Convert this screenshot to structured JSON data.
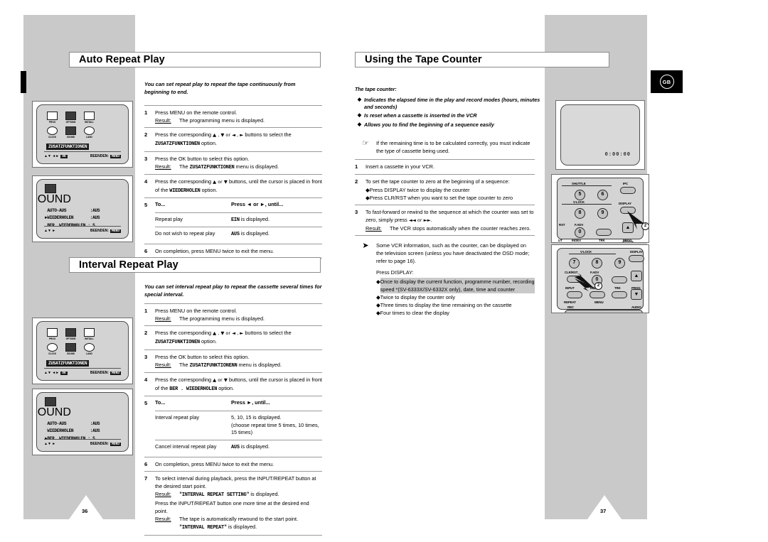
{
  "document": {
    "language_badge": "GB",
    "left_page_number": "36",
    "right_page_number": "37"
  },
  "left_page": {
    "sections": [
      {
        "title": "Auto Repeat Play",
        "intro": "You can set repeat play to repeat the tape continuously from beginning to end.",
        "steps": [
          {
            "num": "1",
            "text": "Press MENU on the remote control.",
            "result_label": "Result:",
            "result": "The programming menu is displayed."
          },
          {
            "num": "2",
            "text_a": "Press the corresponding",
            "keys": "▲ , ▼ or ◄ , ►",
            "text_b": "buttons to select the",
            "mono": "ZUSATZFUNKTIONEN",
            "text_c": "option."
          },
          {
            "num": "3",
            "text": "Press the OK  button to select this option.",
            "result_label": "Result:",
            "result_a": "The",
            "mono": "ZUSATZFUNKTIONEN",
            "result_b": "menu is displayed."
          },
          {
            "num": "4",
            "text_a": "Press the corresponding",
            "keys": "▲ or ▼",
            "text_b": "buttons, until the cursor is placed in front of the",
            "mono": "WIEDERHOLEN",
            "text_c": "option."
          },
          {
            "num": "5",
            "col1_header": "To...",
            "col2_header": "Press ◄ or ►, until...",
            "rows": [
              {
                "c1": "Repeat play",
                "c2_mono": "EIN",
                "c2": "is displayed."
              },
              {
                "c1": "Do not wish to repeat play",
                "c2_mono": "AUS",
                "c2": "is displayed."
              }
            ]
          },
          {
            "num": "6",
            "text": "On completion, press MENU twice to exit the menu."
          }
        ],
        "osd_menu": {
          "icons": [
            {
              "label": "PROG"
            },
            {
              "label": "OPTIONS"
            },
            {
              "label": "INSTALL"
            },
            {
              "label": "CLOCK"
            },
            {
              "label": "SOUND"
            },
            {
              "label": "LANG"
            }
          ],
          "highlight": "ZUSATZFUNKTIONEN",
          "footer_left": "▲▼  ◄►",
          "footer_key": "OK",
          "footer_right": "BEENDEN:",
          "footer_right_key": "MENU"
        },
        "osd_sub": {
          "icon_label": "SOUND",
          "lines": [
            " AUTO-AUS          :AUS",
            "►WIEDERHOLEN       :AUS",
            " BER. WIEDERHOLEN : 5"
          ],
          "footer_left": "▲▼    ►",
          "footer_right": "BEENDEN:",
          "footer_right_key": "MENU"
        }
      },
      {
        "title": "Interval Repeat Play",
        "intro": "You can set interval repeat play to repeat the cassette several times for special interval.",
        "steps": [
          {
            "num": "1",
            "text": "Press MENU on the remote control.",
            "result_label": "Result:",
            "result": "The programming menu is displayed."
          },
          {
            "num": "2",
            "text_a": "Press the corresponding",
            "keys": "▲ , ▼ or ◄ , ►",
            "text_b": "buttons to select the",
            "mono": "ZUSATZFUNKTIONEN",
            "text_c": "option."
          },
          {
            "num": "3",
            "text": "Press the OK button to select this option.",
            "result_label": "Result:",
            "result_a": "The",
            "mono": "ZUSATZFUNKTIONENN",
            "result_b": "menu is displayed."
          },
          {
            "num": "4",
            "text_a": "Press the corresponding",
            "keys": "▲ or ▼",
            "text_b": "buttons, until the cursor is placed in front of the",
            "mono": "BER . WIEDERHOLEN",
            "text_c": "option."
          },
          {
            "num": "5",
            "col1_header": "To...",
            "col2_header": "Press ►, until...",
            "rows": [
              {
                "c1": "Interval repeat play",
                "c2": "5, 10, 15 is displayed.",
                "c2_extra": "(choose repeat time 5 times, 10 times, 15 times)"
              },
              {
                "c1": "Cancel interval repeat play",
                "c2_mono": "AUS",
                "c2": "is displayed."
              }
            ]
          },
          {
            "num": "6",
            "text": "On completion, press MENU twice to exit the menu."
          },
          {
            "num": "7",
            "text": "To select interval during playback, press the INPUT/REPEAT button at the desired start point.",
            "result_label": "Result:",
            "result_mono": "\"INTERVAL REPEAT SETTING\"",
            "result_tail": "is displayed.",
            "text2": "Press the INPUT/REPEAT button one more time at the desired end point.",
            "result_label2": "Result:",
            "result2": "The tape is automatically rewound to the start point.",
            "result2_mono": "\"INTERVAL REPEAT\"",
            "result2_tail": "is displayed."
          }
        ],
        "osd_menu": {
          "icons": [
            {
              "label": "PROG"
            },
            {
              "label": "OPTIONS"
            },
            {
              "label": "INSTALL"
            },
            {
              "label": "CLOCK"
            },
            {
              "label": "SOUND"
            },
            {
              "label": "LANG"
            }
          ],
          "highlight": "ZUSATZFUNKTIONEN",
          "footer_left": "▲▼  ◄►",
          "footer_key": "OK",
          "footer_right": "BEENDEN:",
          "footer_right_key": "MENU"
        },
        "osd_sub": {
          "icon_label": "SOUND",
          "lines": [
            " AUTO-AUS          :AUS",
            " WIEDERHOLEN       :AUS",
            "►BER. WIEDERHOLEN : 5"
          ],
          "footer_left": "▲▼    ►",
          "footer_right": "BEENDEN:",
          "footer_right_key": "MENU"
        }
      }
    ]
  },
  "right_page": {
    "section": {
      "title": "Using the Tape Counter",
      "lead": "The tape counter:",
      "bullets": [
        "Indicates the elapsed time in the play and record modes (hours, minutes and seconds)",
        "Is reset when a cassette is inserted in the VCR",
        "Allows you to find the beginning of a sequence easily"
      ],
      "hand_note": "If the remaining time is to be calculated correctly, you must indicate the type of cassette being used.",
      "steps": [
        {
          "num": "1",
          "text": "Insert a cassette in your VCR."
        },
        {
          "num": "2",
          "text": "To set the tape counter to zero at the beginning of a sequence:",
          "bullets": [
            "Press DISPLAY twice to display the counter",
            "Press CLR/RST when you want to set the tape counter to zero"
          ]
        },
        {
          "num": "3",
          "text_a": "To fast-forward or rewind to the sequence at which the counter was set to zero, simply press",
          "keys": "◄◄ or ►►",
          "text_b": ".",
          "result_label": "Result:",
          "result": "The VCR stops automatically when the counter reaches zero."
        }
      ],
      "arrow_note": {
        "text": "Some VCR information, such as the counter, can be displayed on the television screen (unless you have deactivated the OSD mode; refer to page 16).",
        "press_label": "Press DISPLAY:",
        "bullets": [
          "Once to display the current function, programme number, recording speed *(SV-6333X/SV-6332X only), date, time and counter",
          "Twice to display the counter only",
          "Three times to display the time remaining on the cassette",
          "Four times to clear the display"
        ]
      },
      "tv_screen": {
        "counter": "0:00:00"
      },
      "remote_top": {
        "labels": [
          "SHUTTLE",
          "V-LOCK",
          "IPC",
          "DISPLAY",
          "F.ADV",
          "TRK",
          "PROG",
          "RST",
          "INDEX",
          "UT"
        ],
        "numbers": [
          "5",
          "6",
          "8",
          "9",
          "0"
        ],
        "callout": "2"
      },
      "remote_bottom": {
        "labels": [
          "V-LOCK",
          "DISPLAY",
          "CLR/RST",
          "F.ADV",
          "TRK",
          "PROG",
          "INPUT",
          "INDEX",
          "REPEAT",
          "MENU",
          "REC",
          "AUDIO"
        ],
        "numbers": [
          "7",
          "8",
          "9",
          "0"
        ],
        "callout": "2"
      }
    }
  }
}
